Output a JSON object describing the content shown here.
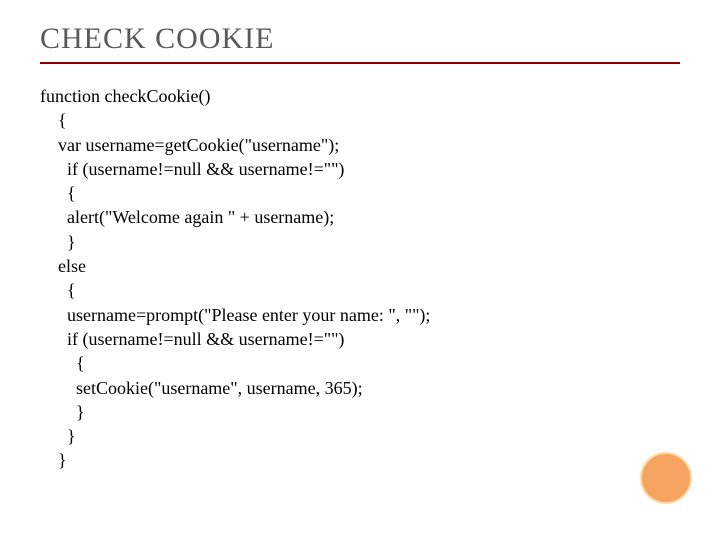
{
  "title": "CHECK COOKIE",
  "code": {
    "l0": "function checkCookie()",
    "l1": "    {",
    "l2": "    var username=getCookie(\"username\");",
    "l3": "      if (username!=null && username!=\"\")",
    "l4": "      {",
    "l5": "      alert(\"Welcome again \" + username);",
    "l6": "      }",
    "l7": "    else",
    "l8": "      {",
    "l9": "      username=prompt(\"Please enter your name: \", \"\");",
    "l10": "      if (username!=null && username!=\"\")",
    "l11": "        {",
    "l12": "        setCookie(\"username\", username, 365);",
    "l13": "        }",
    "l14": "      }",
    "l15": "    }"
  }
}
